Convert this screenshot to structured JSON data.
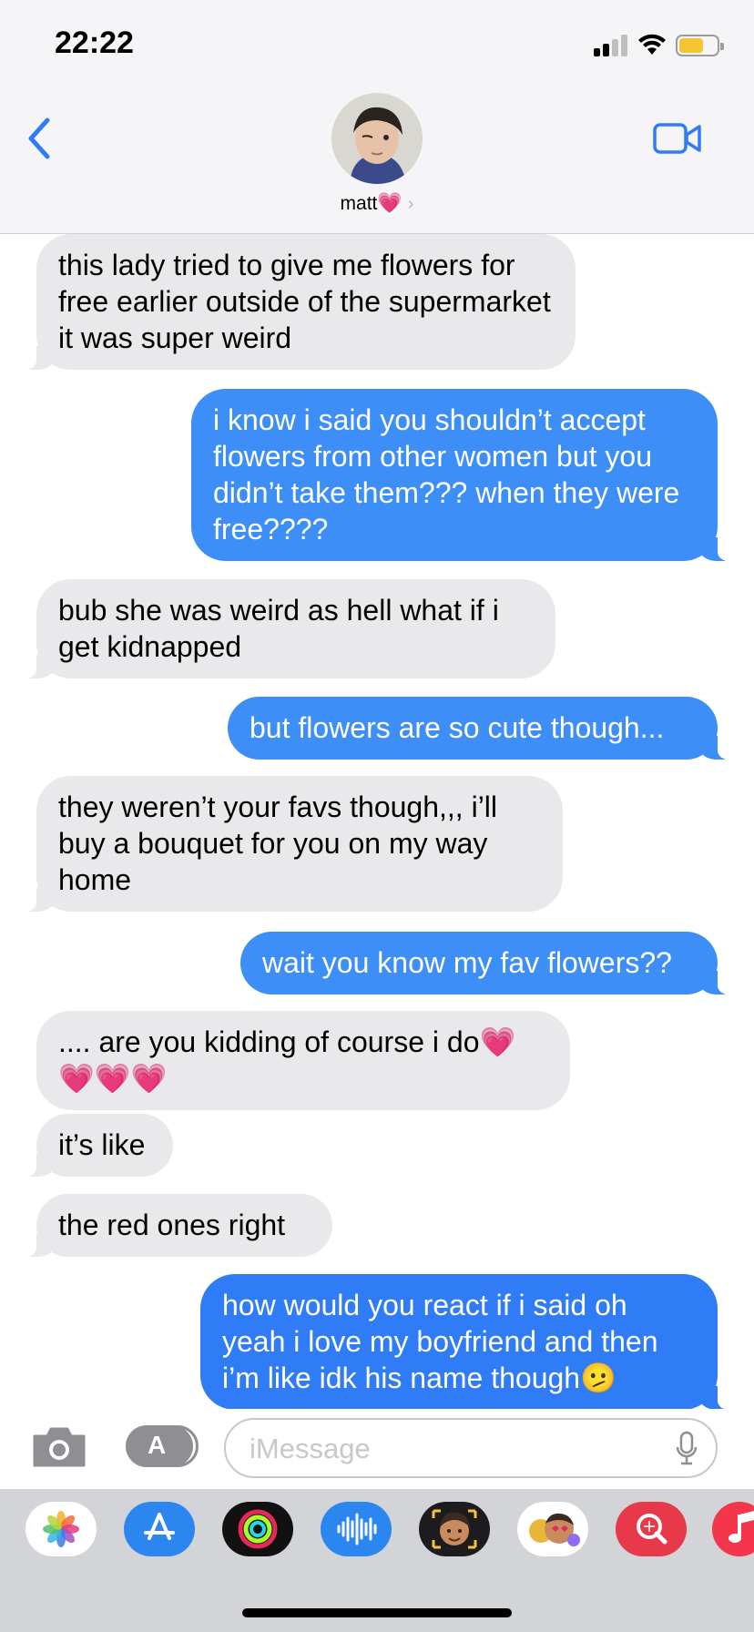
{
  "status": {
    "time": "22:22",
    "battery_color": "#f4c531"
  },
  "header": {
    "contact_name": "matt",
    "contact_emoji": "💗",
    "chevron": "›",
    "back_icon": "chevron-left-icon",
    "video_icon": "video-camera-icon"
  },
  "messages": [
    {
      "dir": "in",
      "text": "this lady tried to give me flowers for free earlier outside of the supermarket it was super weird"
    },
    {
      "dir": "out",
      "text": "i know i said you shouldn’t accept flowers from other women but you didn’t take them??? when they were free????"
    },
    {
      "dir": "in",
      "text": "bub she was weird as hell what if i get kidnapped"
    },
    {
      "dir": "out",
      "text": "but flowers are so cute though..."
    },
    {
      "dir": "in",
      "text": "they weren’t your favs though,,, i’ll buy a bouquet for you on my way home"
    },
    {
      "dir": "out",
      "text": "wait you know my fav flowers??"
    },
    {
      "dir": "in",
      "text": ".... are you kidding of course i do💗💗💗💗"
    },
    {
      "dir": "in",
      "text": "it’s like"
    },
    {
      "dir": "in",
      "text": "the red ones right"
    },
    {
      "dir": "out",
      "text": "how would you react if i said oh yeah i love my boyfriend and then i’m like idk his name though🫤"
    }
  ],
  "compose": {
    "placeholder": "iMessage",
    "value": "",
    "apps_glyph": "A"
  },
  "drawer": {
    "apps": [
      "photos-app",
      "app-store-app",
      "activity-app",
      "audio-message-app",
      "memoji-app",
      "animoji-app",
      "image-search-app",
      "music-app"
    ]
  },
  "colors": {
    "incoming_bubble": "#e9e9eb",
    "outgoing_bubble": "#3d8ef7",
    "accent": "#2f7cf6"
  }
}
